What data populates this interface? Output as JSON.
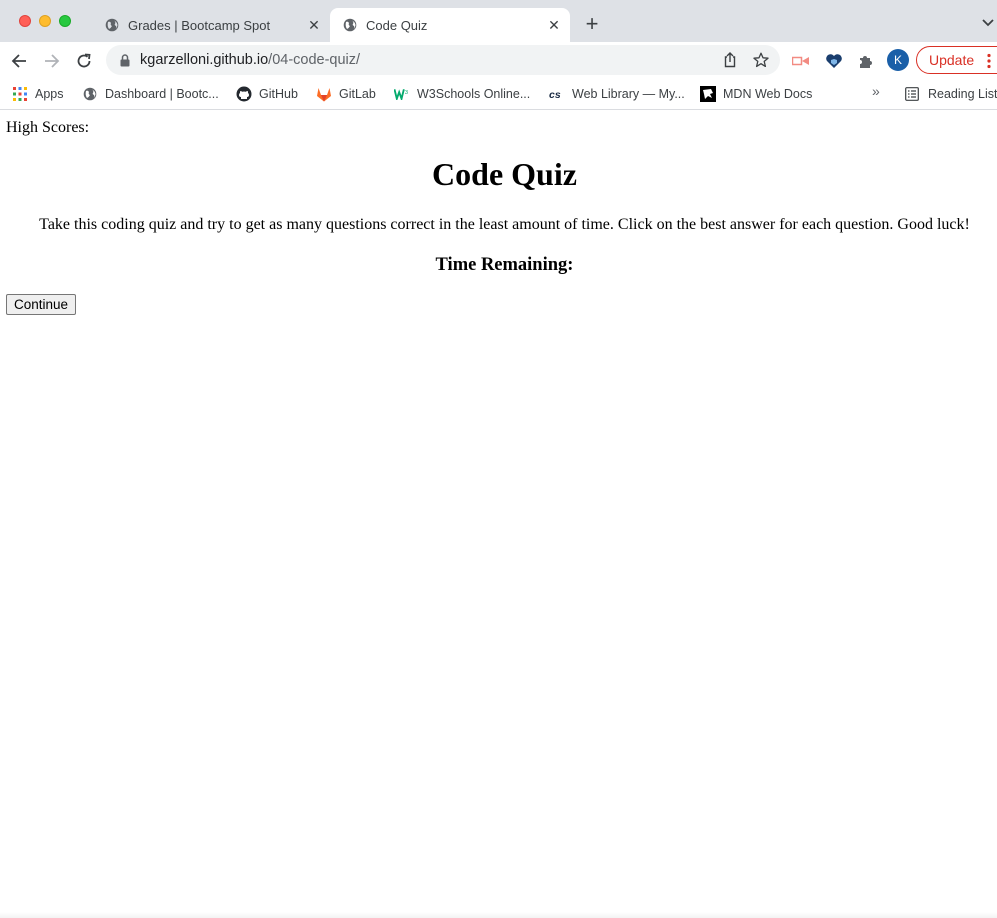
{
  "browser": {
    "tabs": [
      {
        "title": "Grades | Bootcamp Spot",
        "close": "✕"
      },
      {
        "title": "Code Quiz",
        "close": "✕"
      }
    ],
    "new_tab": "+",
    "address": {
      "domain": "kgarzelloni.github.io",
      "path": "/04-code-quiz/"
    },
    "profile_initial": "K",
    "update_label": "Update",
    "bookmarks": [
      {
        "label": "Apps",
        "icon": "apps-grid-icon"
      },
      {
        "label": "Dashboard | Bootc...",
        "icon": "globe-icon"
      },
      {
        "label": "GitHub",
        "icon": "github-icon"
      },
      {
        "label": "GitLab",
        "icon": "gitlab-icon"
      },
      {
        "label": "W3Schools Online...",
        "icon": "w3schools-icon"
      },
      {
        "label": "Web Library — My...",
        "icon": "cs-icon"
      },
      {
        "label": "MDN Web Docs",
        "icon": "mdn-icon"
      }
    ],
    "bookmarks_overflow": "»",
    "reading_list": "Reading List"
  },
  "page": {
    "high_scores": "High Scores:",
    "title": "Code Quiz",
    "intro": "Take this coding quiz and try to get as many questions correct in the least amount of time. Click on the best answer for each question. Good luck!",
    "timer_label": "Time Remaining:",
    "continue_label": "Continue"
  },
  "colors": {
    "tab_strip": "#dee1e6",
    "update_red": "#d93025",
    "profile_blue": "#1a5fa8"
  }
}
